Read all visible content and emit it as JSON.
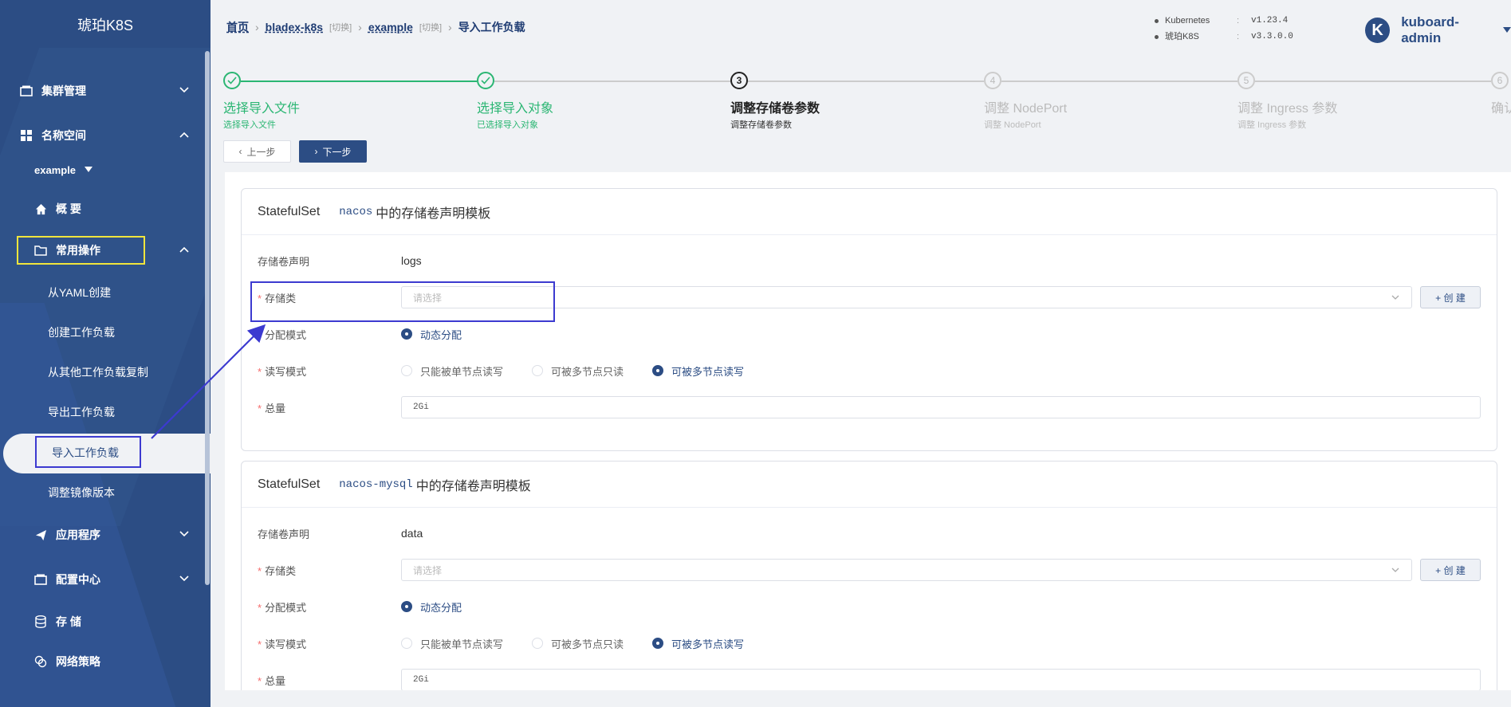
{
  "sidebar": {
    "logo": "琥珀K8S",
    "cluster_mgmt": "集群管理",
    "namespace": "名称空间",
    "ns_selected": "example",
    "overview": "概 要",
    "common_ops": "常用操作",
    "sub_items": [
      "从YAML创建",
      "创建工作负载",
      "从其他工作负载复制",
      "导出工作负载",
      "导入工作负载",
      "调整镜像版本"
    ],
    "applications": "应用程序",
    "config_center": "配置中心",
    "storage": "存 储",
    "network_policy": "网络策略"
  },
  "breadcrumb": {
    "home": "首页",
    "cluster": "bladex-k8s",
    "switch1": "[切换]",
    "namespace": "example",
    "switch2": "[切换]",
    "current": "导入工作负载"
  },
  "versions": [
    {
      "name": "Kubernetes",
      "value": "v1.23.4"
    },
    {
      "name": "琥珀K8S",
      "value": "v3.3.0.0"
    }
  ],
  "user": {
    "avatar_letter": "K",
    "name": "kuboard-admin"
  },
  "steps": [
    {
      "num": "1",
      "title": "选择导入文件",
      "desc": "选择导入文件",
      "state": "done"
    },
    {
      "num": "2",
      "title": "选择导入对象",
      "desc": "已选择导入对象",
      "state": "done"
    },
    {
      "num": "3",
      "title": "调整存储卷参数",
      "desc": "调整存储卷参数",
      "state": "current"
    },
    {
      "num": "4",
      "title": "调整 NodePort",
      "desc": "调整 NodePort",
      "state": "todo"
    },
    {
      "num": "5",
      "title": "调整 Ingress 参数",
      "desc": "调整 Ingress 参数",
      "state": "todo"
    },
    {
      "num": "6",
      "title": "确认",
      "desc": "",
      "state": "todo"
    }
  ],
  "buttons": {
    "prev": "上一步",
    "next": "下一步",
    "create": "+ 创 建"
  },
  "form_labels": {
    "pvc": "存储卷声明",
    "storage_class": "存储类",
    "alloc_mode": "分配模式",
    "rw_mode": "读写模式",
    "total": "总量",
    "select_placeholder": "请选择",
    "dynamic": "动态分配",
    "rwo": "只能被单节点读写",
    "rox": "可被多节点只读",
    "rwx": "可被多节点读写"
  },
  "cards": [
    {
      "kind": "StatefulSet",
      "name": "nacos",
      "suffix": "中的存储卷声明模板",
      "pvc": "logs",
      "total": "2Gi"
    },
    {
      "kind": "StatefulSet",
      "name": "nacos-mysql",
      "suffix": "中的存储卷声明模板",
      "pvc": "data",
      "total": "2Gi"
    }
  ],
  "colors": {
    "primary": "#2c4d84",
    "success": "#2bb673",
    "highlight": "#3c3ad0",
    "yellow": "#f1e53c"
  }
}
